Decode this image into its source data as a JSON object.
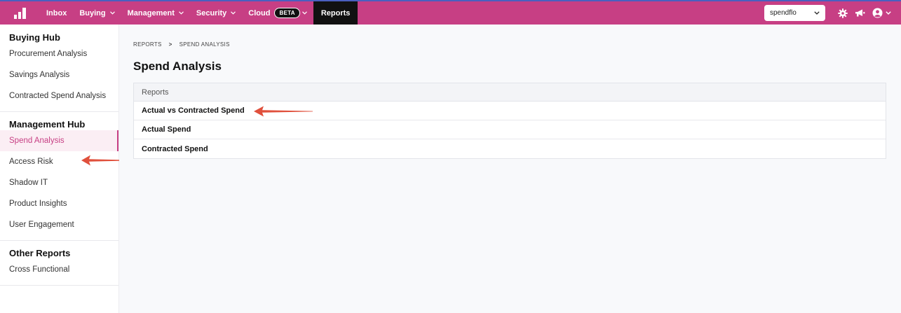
{
  "topbar": {
    "nav": [
      {
        "label": "Inbox",
        "has_menu": false
      },
      {
        "label": "Buying",
        "has_menu": true
      },
      {
        "label": "Management",
        "has_menu": true
      },
      {
        "label": "Security",
        "has_menu": true
      },
      {
        "label": "Cloud",
        "badge": "BETA",
        "has_menu": true
      },
      {
        "label": "Reports",
        "active": true
      }
    ],
    "org_select": "spendflo",
    "icons": [
      "gear-icon",
      "megaphone-icon",
      "user-avatar-icon",
      "chevron-down-icon"
    ]
  },
  "sidebar": {
    "sections": [
      {
        "title": "Buying Hub",
        "items": [
          "Procurement Analysis",
          "Savings Analysis",
          "Contracted Spend Analysis"
        ]
      },
      {
        "title": "Management Hub",
        "items": [
          "Spend Analysis",
          "Access Risk",
          "Shadow IT",
          "Product Insights",
          "User Engagement"
        ],
        "active_item": "Spend Analysis"
      },
      {
        "title": "Other Reports",
        "items": [
          "Cross Functional"
        ]
      }
    ]
  },
  "main": {
    "breadcrumb": [
      "REPORTS",
      "SPEND ANALYSIS"
    ],
    "breadcrumb_sep": ">",
    "title": "Spend Analysis",
    "card_header": "Reports",
    "reports": [
      "Actual vs Contracted Spend",
      "Actual Spend",
      "Contracted Spend"
    ]
  },
  "colors": {
    "brand": "#c73f84",
    "active_bg": "#fbeef4",
    "annotation_arrow": "#e0503c"
  }
}
